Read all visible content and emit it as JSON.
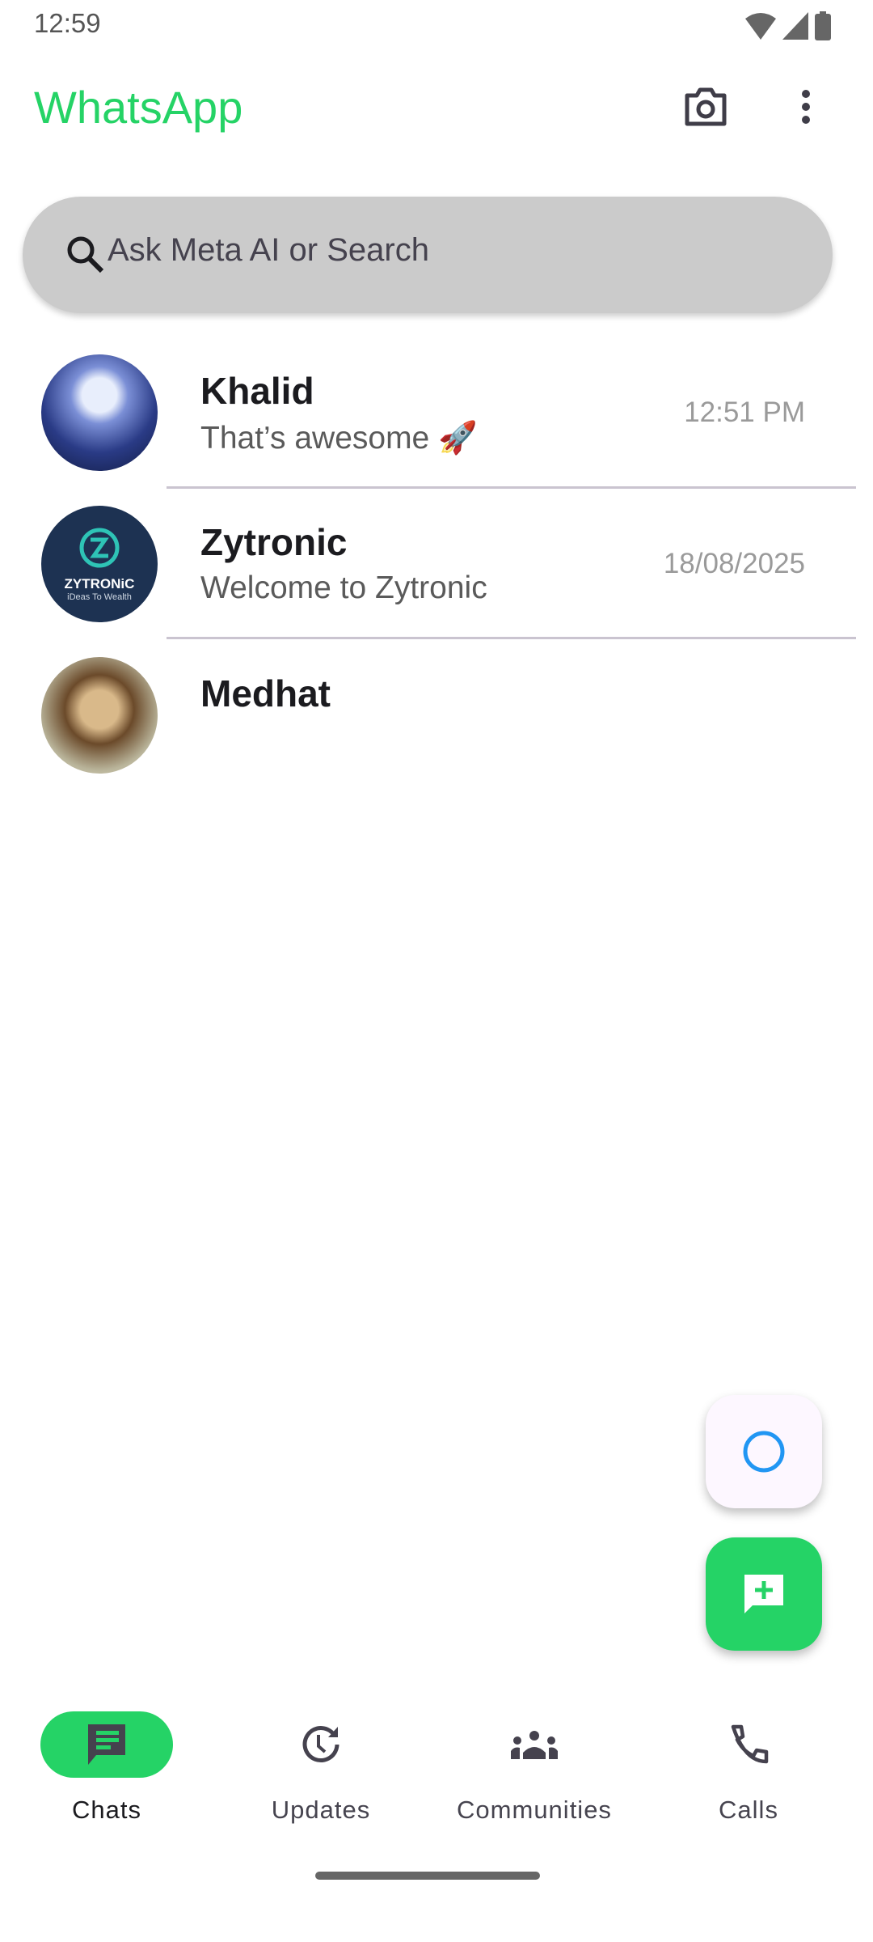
{
  "status_bar": {
    "time": "12:59"
  },
  "header": {
    "title": "WhatsApp"
  },
  "search": {
    "placeholder": "Ask Meta AI or Search"
  },
  "chats": [
    {
      "name": "Khalid",
      "message": "That’s awesome 🚀",
      "time": "12:51 PM"
    },
    {
      "name": "Zytronic",
      "message": "Welcome to Zytronic",
      "time": "18/08/2025",
      "avatar_text": "ZYTRONiC",
      "avatar_sub": "iDeas To Wealth"
    },
    {
      "name": "Medhat",
      "message": "",
      "time": ""
    }
  ],
  "nav": [
    {
      "label": "Chats",
      "icon": "chat-icon",
      "active": true
    },
    {
      "label": "Updates",
      "icon": "updates-icon"
    },
    {
      "label": "Communities",
      "icon": "communities-icon"
    },
    {
      "label": "Calls",
      "icon": "phone-icon"
    }
  ],
  "colors": {
    "brand": "#25D366",
    "search_bg": "#cbcbcb",
    "meta_ai_ring": "#2196f3"
  }
}
